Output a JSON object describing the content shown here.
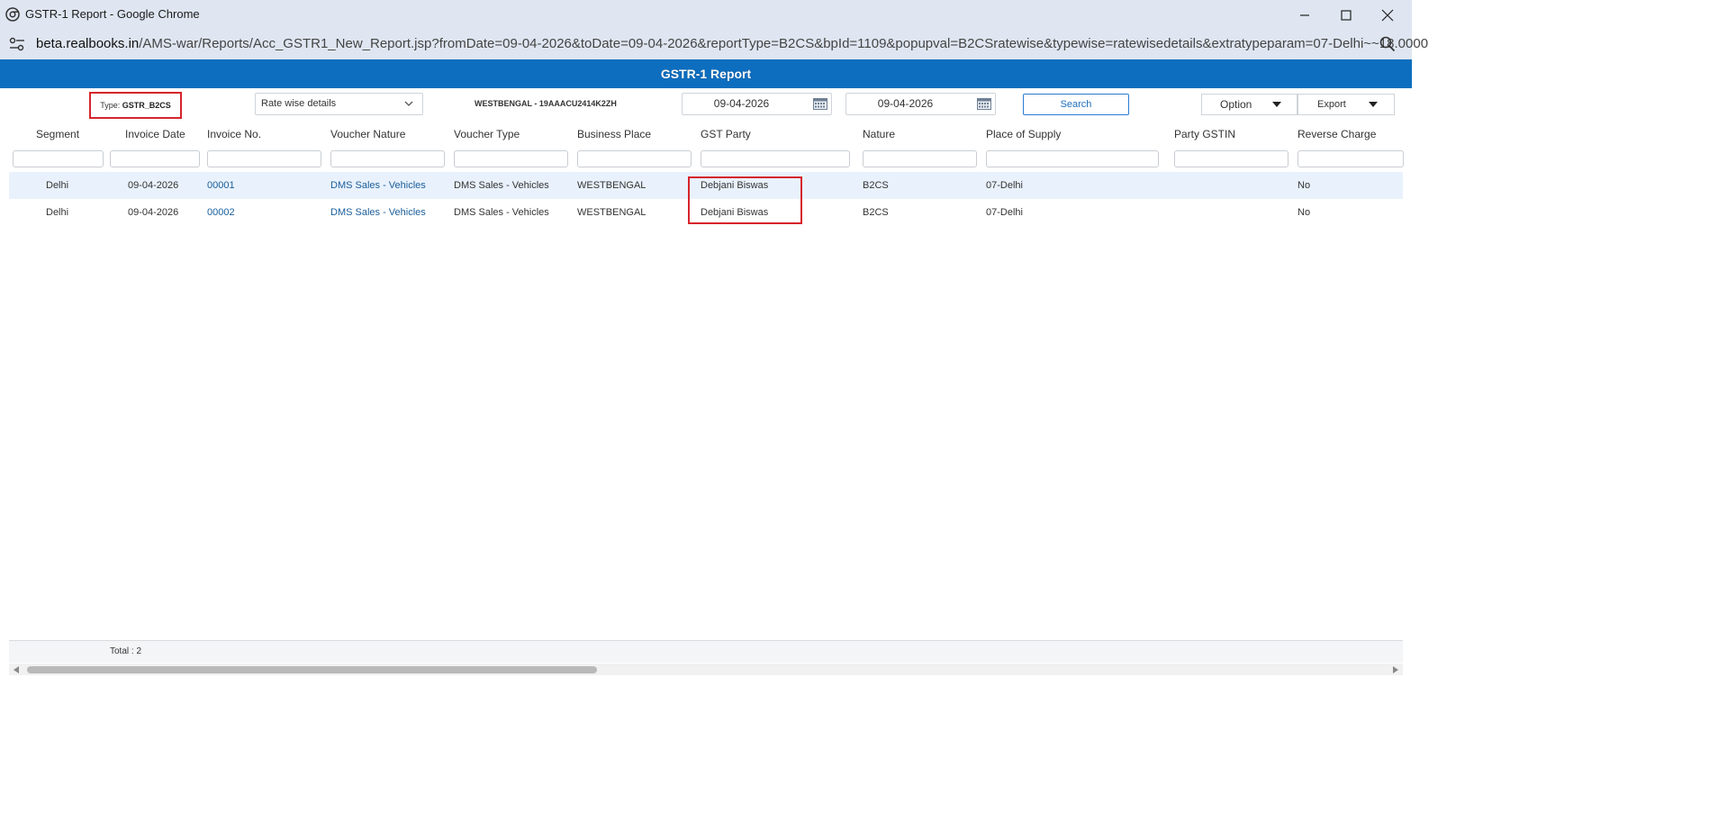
{
  "window": {
    "title": "GSTR-1 Report - Google Chrome",
    "url_host": "beta.realbooks.in",
    "url_path": "/AMS-war/Reports/Acc_GSTR1_New_Report.jsp?fromDate=09-04-2026&toDate=09-04-2026&reportType=B2CS&bpId=1109&popupval=B2CSratewise&typewise=ratewisedetails&extratypeparam=07-Delhi~~18.0000"
  },
  "report": {
    "title": "GSTR-1 Report",
    "type_label": "Type:",
    "type_value": "GSTR_B2CS",
    "view_select": "Rate wise details",
    "gstin": "WESTBENGAL - 19AAACU2414K2ZH",
    "from_date": "09-04-2026",
    "to_date": "09-04-2026",
    "search_label": "Search",
    "option_label": "Option",
    "export_label": "Export"
  },
  "columns": [
    "Segment",
    "Invoice Date",
    "Invoice No.",
    "Voucher Nature",
    "Voucher Type",
    "Business Place",
    "GST Party",
    "Nature",
    "Place of Supply",
    "Party GSTIN",
    "Reverse Charge"
  ],
  "rows": [
    {
      "segment": "Delhi",
      "invoice_date": "09-04-2026",
      "invoice_no": "00001",
      "voucher_nature": "DMS Sales - Vehicles",
      "voucher_type": "DMS Sales - Vehicles",
      "business_place": "WESTBENGAL",
      "gst_party": "Debjani Biswas",
      "nature": "B2CS",
      "place_of_supply": "07-Delhi",
      "party_gstin": "",
      "reverse_charge": "No"
    },
    {
      "segment": "Delhi",
      "invoice_date": "09-04-2026",
      "invoice_no": "00002",
      "voucher_nature": "DMS Sales - Vehicles",
      "voucher_type": "DMS Sales - Vehicles",
      "business_place": "WESTBENGAL",
      "gst_party": "Debjani Biswas",
      "nature": "B2CS",
      "place_of_supply": "07-Delhi",
      "party_gstin": "",
      "reverse_charge": "No"
    }
  ],
  "footer": {
    "total": "Total : 2"
  },
  "colors": {
    "header_bg": "#0d6ebf",
    "highlight": "#d6242b",
    "row_alt": "#e9f2fc",
    "link": "#1a5e9a"
  },
  "icons": [
    "chrome-icon",
    "minimize-icon",
    "maximize-icon",
    "close-icon",
    "site-settings-icon",
    "zoom-icon",
    "chevron-down-icon",
    "calendar-icon",
    "caret-down-icon"
  ]
}
